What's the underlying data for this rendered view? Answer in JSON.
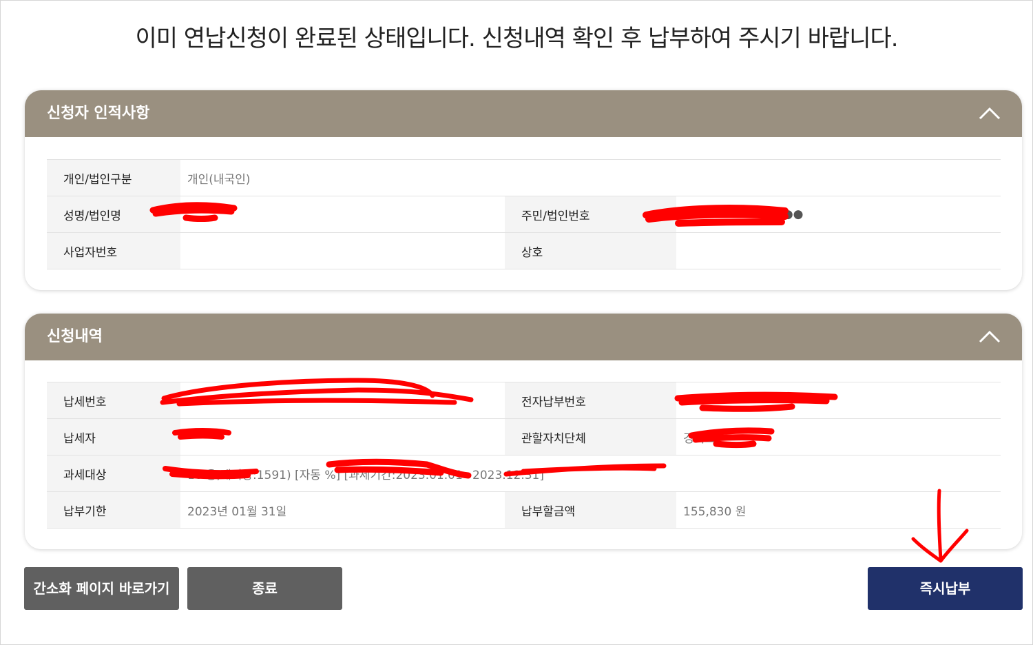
{
  "notice": "이미 연납신청이 완료된 상태입니다. 신청내역 확인 후 납부하여 주시기 바랍니다.",
  "applicant_panel": {
    "title": "신청자 인적사항",
    "rows": {
      "type_label": "개인/법인구분",
      "type_value": "개인(내국인)",
      "name_label": "성명/법인명",
      "name_value": "",
      "idnum_label": "주민/법인번호",
      "idnum_value": "●●●",
      "biznum_label": "사업자번호",
      "biznum_value": "",
      "company_label": "상호",
      "company_value": ""
    }
  },
  "request_panel": {
    "title": "신청내역",
    "rows": {
      "taxnum_label": "납세번호",
      "taxnum_value": "",
      "epay_label": "전자납부번호",
      "epay_value": "",
      "taxpayer_label": "납세자",
      "taxpayer_value": "",
      "authority_label": "관할자치단체",
      "authority_value": "경기도",
      "object_label": "과세대상",
      "object_value": "10 용,배기량:1591) [자동 %] [과세기간:2023.01.01~2023.12.31]",
      "due_label": "납부기한",
      "due_value": "2023년 01월 31일",
      "amount_label": "납부할금액",
      "amount_value": "155,830 원"
    }
  },
  "buttons": {
    "simple_page": "간소화 페이지 바로가기",
    "close": "종료",
    "pay_now": "즉시납부"
  },
  "colors": {
    "panel_header": "#9a9080",
    "button_gray": "#606060",
    "button_navy": "#20316a",
    "annotation_red": "#ff0000"
  }
}
